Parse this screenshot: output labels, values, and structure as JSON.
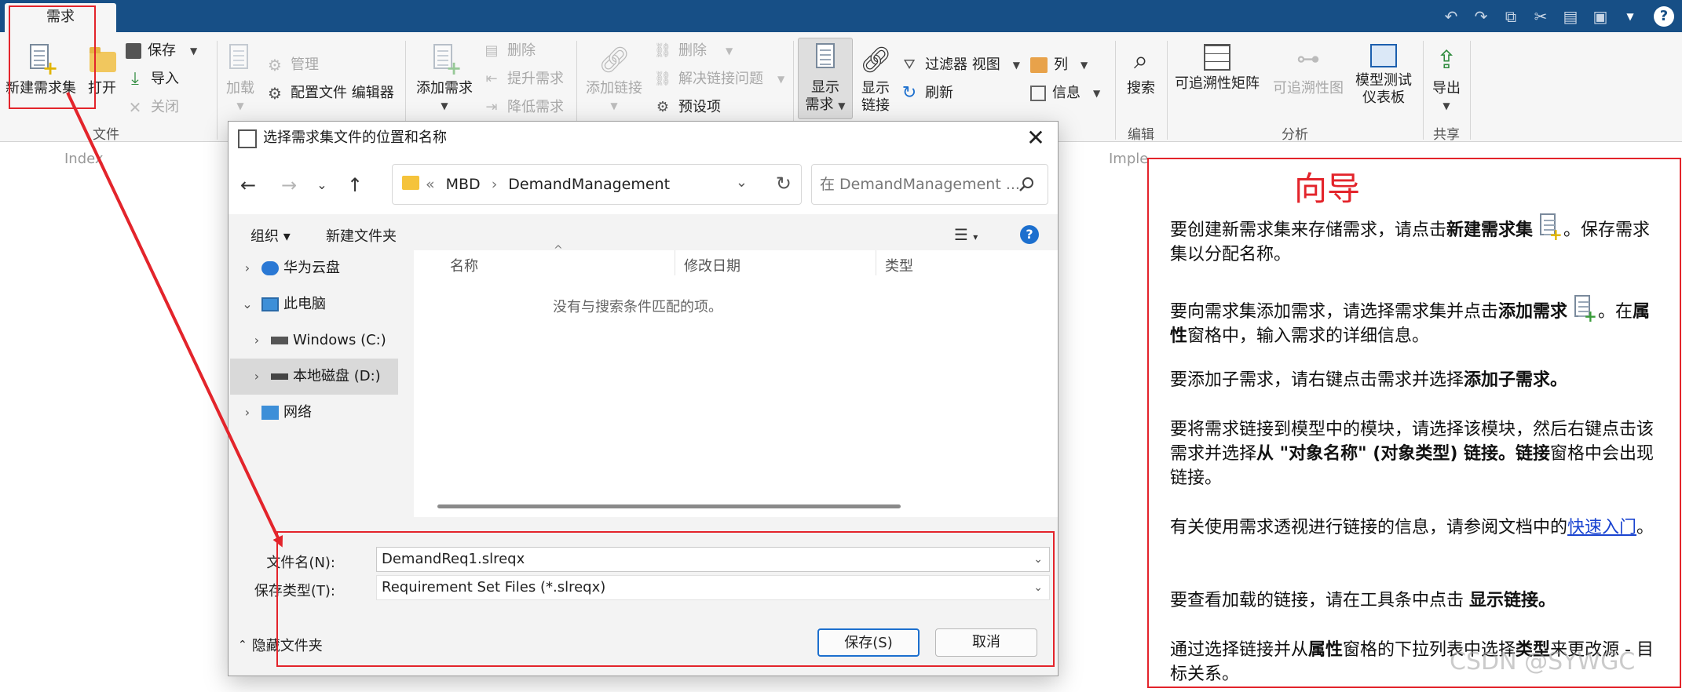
{
  "tabs": {
    "active": "需求"
  },
  "quick_access": {
    "icons": [
      "undo-icon",
      "redo-icon",
      "copy-icon",
      "cut-icon",
      "paste-icon",
      "window-icon",
      "help-icon"
    ],
    "help": "?"
  },
  "ribbon": {
    "file": {
      "new_req_set": "新建需求集",
      "open": "打开",
      "save": "保存",
      "import": "导入",
      "close": "关闭",
      "group_label": "文件"
    },
    "load": "加载",
    "manage": "管理",
    "profile_editor": "配置文件 编辑器",
    "add_req": "添加需求",
    "delete_req": "删除",
    "promote_req": "提升需求",
    "demote_req": "降低需求",
    "add_link": "添加链接",
    "delete_link": "删除",
    "resolve_link": "解决链接问题",
    "preset": "预设项",
    "show_req_l1": "显示",
    "show_req_l2": "需求",
    "show_link_l1": "显示",
    "show_link_l2": "链接",
    "filter_view": "过滤器 视图",
    "refresh": "刷新",
    "columns": "列",
    "info": "信息",
    "search": "搜索",
    "edit_group": "编辑",
    "trace_matrix": "可追溯性矩阵",
    "trace_graph": "可追溯性图",
    "model_test_l1": "模型测试",
    "model_test_l2": "仪表板",
    "analysis_group": "分析",
    "export": "导出",
    "share_group": "共享"
  },
  "background": {
    "index_label": "Index",
    "impl_label": "Imple"
  },
  "dialog": {
    "title": "选择需求集文件的位置和名称",
    "breadcrumb": [
      "«",
      "MBD",
      "›",
      "DemandManagement"
    ],
    "search_placeholder": "在 DemandManagement ...",
    "organize": "组织 ▾",
    "new_folder": "新建文件夹",
    "help": "?",
    "tree": [
      {
        "label": "华为云盘",
        "expanded": false
      },
      {
        "label": "此电脑",
        "expanded": true
      },
      {
        "label": "Windows (C:)",
        "expanded": false
      },
      {
        "label": "本地磁盘 (D:)",
        "expanded": false
      },
      {
        "label": "网络",
        "expanded": false
      }
    ],
    "columns": [
      "名称",
      "修改日期",
      "类型"
    ],
    "empty_message": "没有与搜索条件匹配的项。",
    "filename_label": "文件名(N):",
    "filename_value": "DemandReq1.slreqx",
    "filetype_label": "保存类型(T):",
    "filetype_value": "Requirement Set Files (*.slreqx)",
    "hide_folders": "隐藏文件夹",
    "save_button": "保存(S)",
    "cancel_button": "取消"
  },
  "guide": {
    "title": "向导",
    "p1_a": "要创建新需求集来存储需求，请点击",
    "p1_b": "新建需求集",
    "p1_c": "。保存需求集以分配名称。",
    "p2_a": "要向需求集添加需求，请选择需求集并点击",
    "p2_b": "添加需求",
    "p2_c": "。在",
    "p2_d": "属性",
    "p2_e": "窗格中，输入需求的详细信息。",
    "p3_a": "要添加子需求，请右键点击需求并选择",
    "p3_b": "添加子需求。",
    "p4_a": "要将需求链接到模型中的模块，请选择该模块，然后右键点击该需求并选择",
    "p4_b": "从 \"对象名称\" (对象类型) 链接。",
    "p4_c": "链接",
    "p4_d": "窗格中会出现链接。",
    "p5_a": "有关使用需求透视进行链接的信息，请参阅文档中的",
    "p5_link": "快速入门",
    "p5_b": "。",
    "p6_a": "要查看加载的链接，请在工具条中点击 ",
    "p6_b": "显示链接。",
    "p7_a": "通过选择链接并从",
    "p7_b": "属性",
    "p7_c": "窗格的下拉列表中选择",
    "p7_d": "类型",
    "p7_e": "来更改源 - 目标关系。"
  },
  "watermark": "CSDN @SYWGC",
  "colors": {
    "accent": "#174f86",
    "highlight": "#e3242b",
    "primary_button": "#1c6fce",
    "link": "#1a44d0"
  }
}
